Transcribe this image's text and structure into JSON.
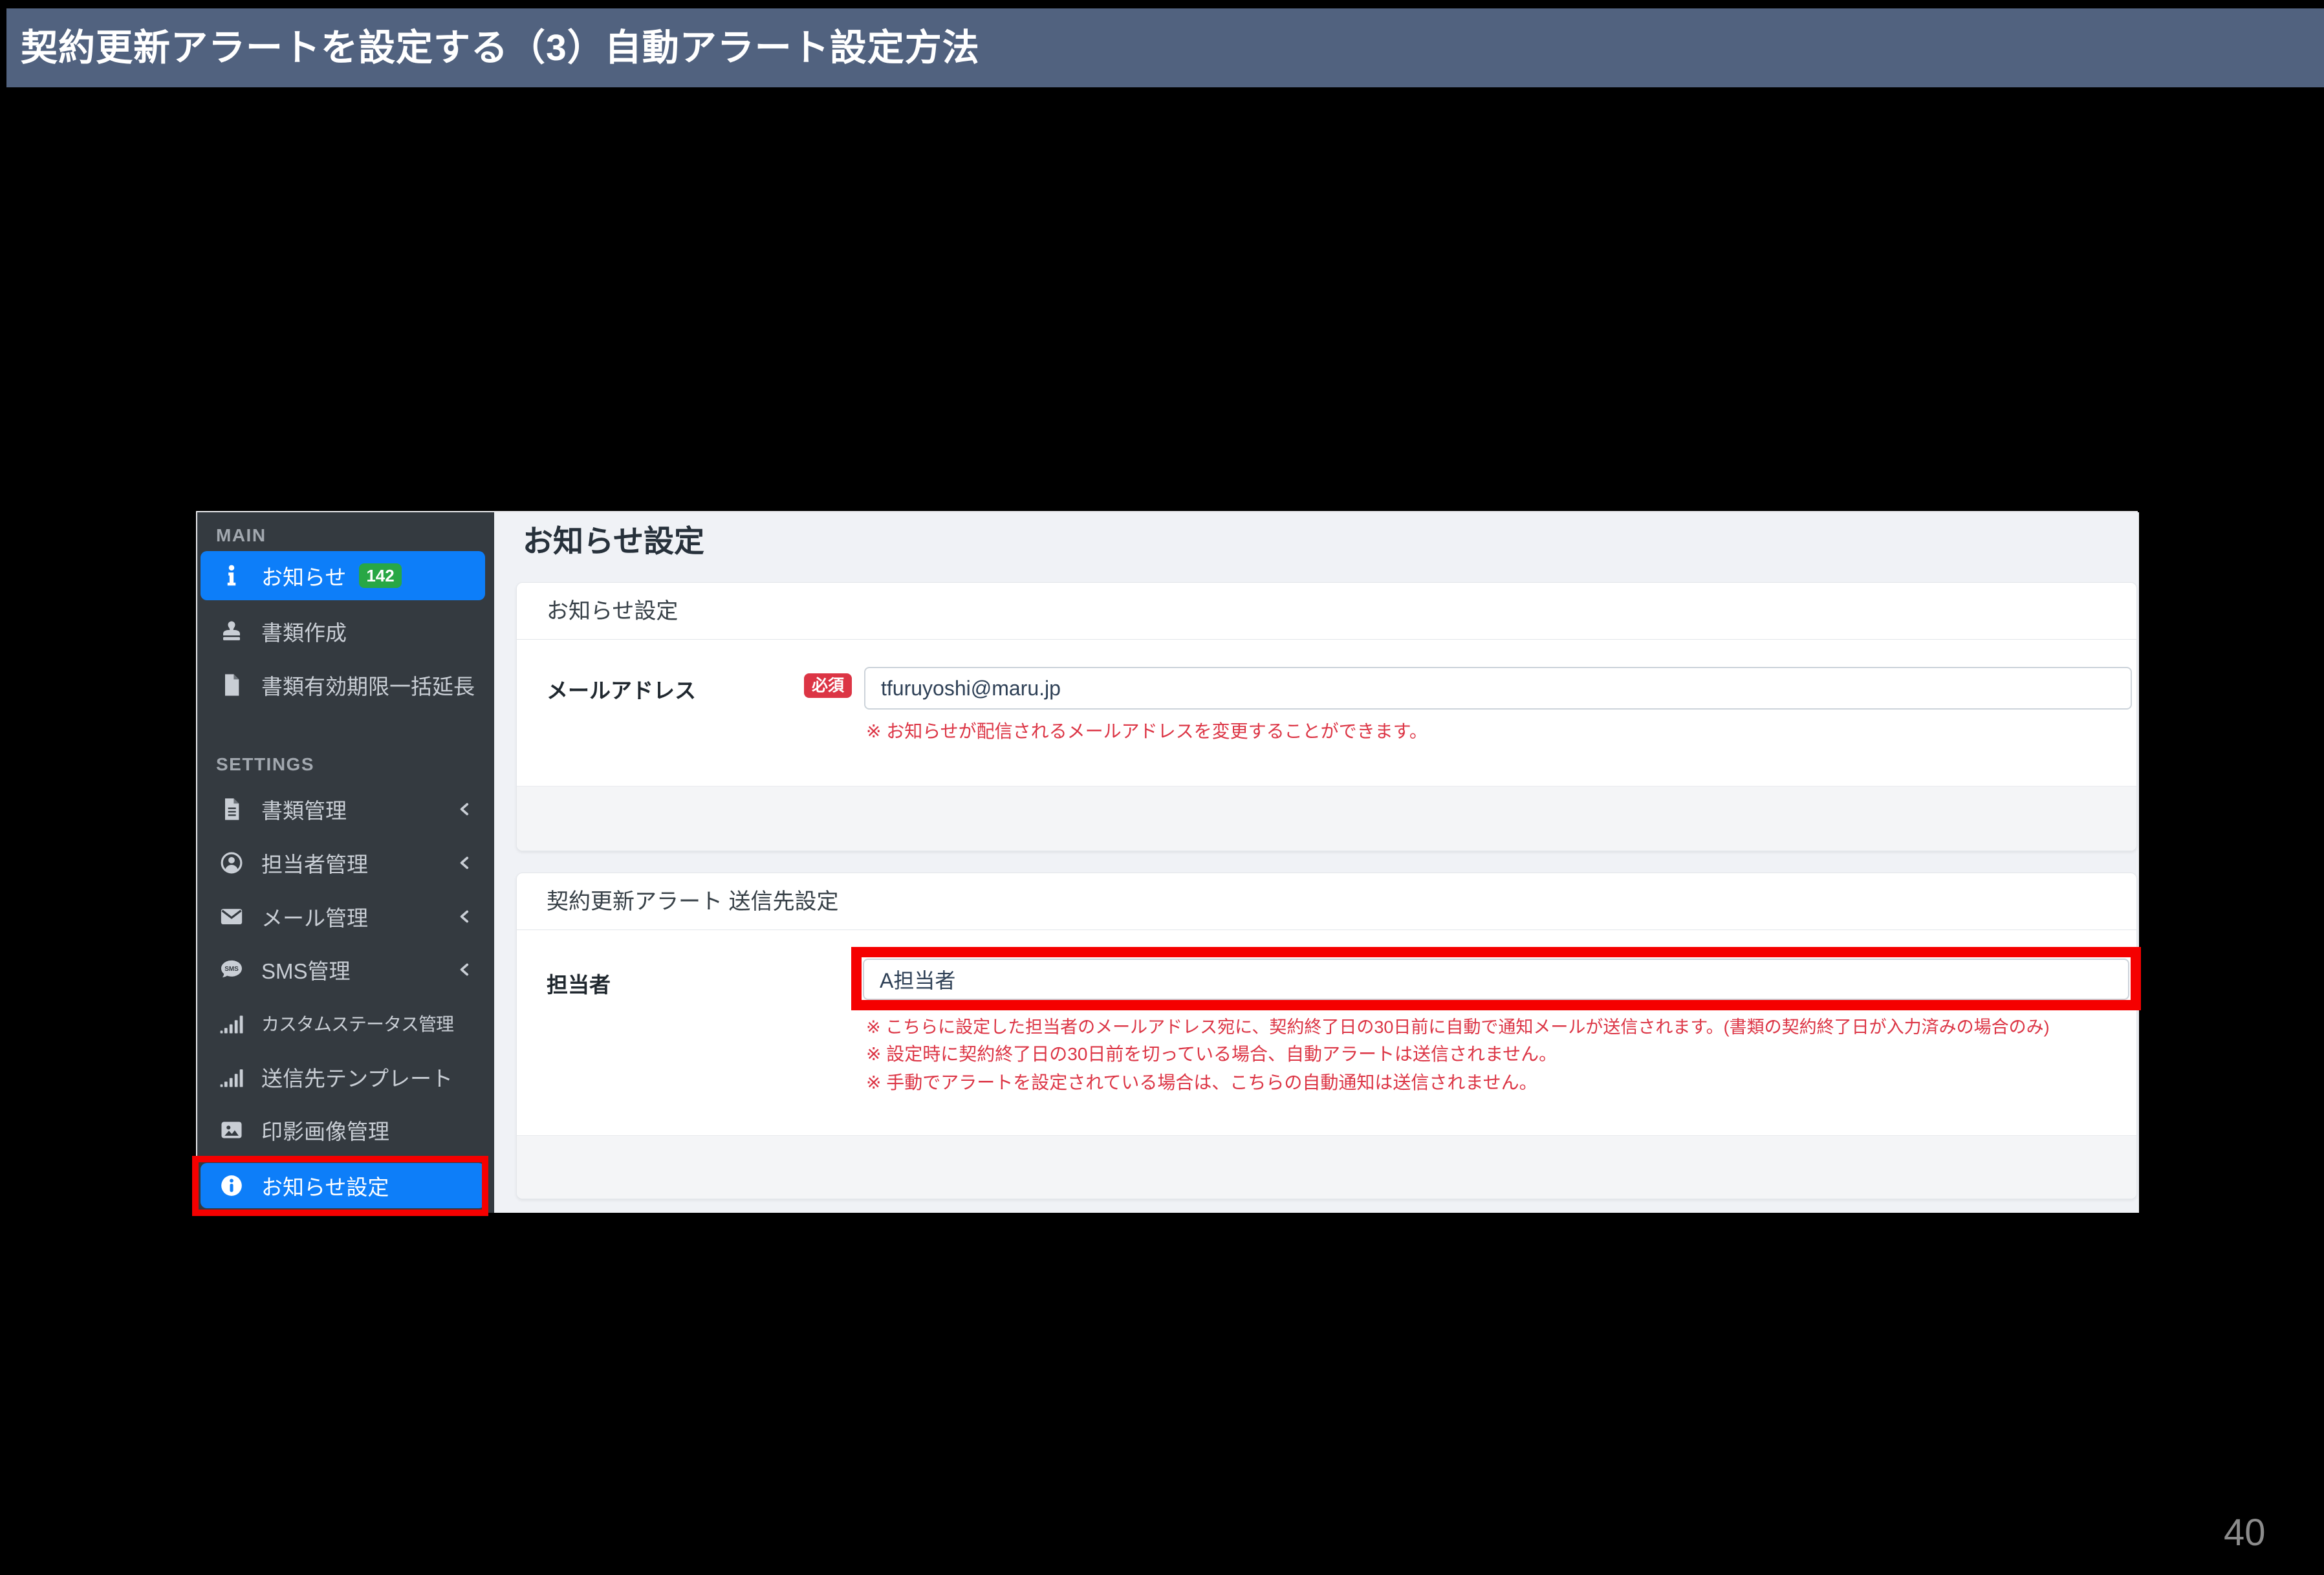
{
  "slide": {
    "title": "契約更新アラートを設定する（3）自動アラート設定方法",
    "page_number": "40",
    "colors": {
      "title_bar": "#51627f",
      "sidebar_bg": "#343a40",
      "active_blue": "#0d7ef9",
      "badge_green": "#28a745",
      "danger_red": "#dc3545",
      "annotation_red": "#f50000",
      "content_bg": "#f0f2f6"
    }
  },
  "sidebar": {
    "section_main_label": "MAIN",
    "section_settings_label": "SETTINGS",
    "items": [
      {
        "label": "お知らせ",
        "icon": "info-icon",
        "badge": "142",
        "active": true
      },
      {
        "label": "書類作成",
        "icon": "stamp-icon"
      },
      {
        "label": "書類有効期限一括延長",
        "icon": "file-icon"
      },
      {
        "label": "書類管理",
        "icon": "file-text-icon",
        "chevron": true
      },
      {
        "label": "担当者管理",
        "icon": "user-circle-icon",
        "chevron": true
      },
      {
        "label": "メール管理",
        "icon": "envelope-icon",
        "chevron": true
      },
      {
        "label": "SMS管理",
        "icon": "sms-bubble-icon",
        "chevron": true
      },
      {
        "label": "カスタムステータス管理",
        "icon": "chart-bars-icon"
      },
      {
        "label": "送信先テンプレート",
        "icon": "chart-bars-icon"
      },
      {
        "label": "印影画像管理",
        "icon": "image-icon"
      },
      {
        "label": "お知らせ設定",
        "icon": "info-circle-icon",
        "active": true,
        "highlighted": true
      }
    ]
  },
  "main": {
    "page_title": "お知らせ設定",
    "card1": {
      "header": "お知らせ設定",
      "email_label": "メールアドレス",
      "required_badge": "必須",
      "email_value": "tfuruyoshi@maru.jp",
      "note": "※ お知らせが配信されるメールアドレスを変更することができます。"
    },
    "card2": {
      "header": "契約更新アラート 送信先設定",
      "person_label": "担当者",
      "person_value": "A担当者",
      "notes": [
        "※ こちらに設定した担当者のメールアドレス宛に、契約終了日の30日前に自動で通知メールが送信されます。(書類の契約終了日が入力済みの場合のみ)",
        "※ 設定時に契約終了日の30日前を切っている場合、自動アラートは送信されません。",
        "※ 手動でアラートを設定されている場合は、こちらの自動通知は送信されません。"
      ]
    }
  }
}
